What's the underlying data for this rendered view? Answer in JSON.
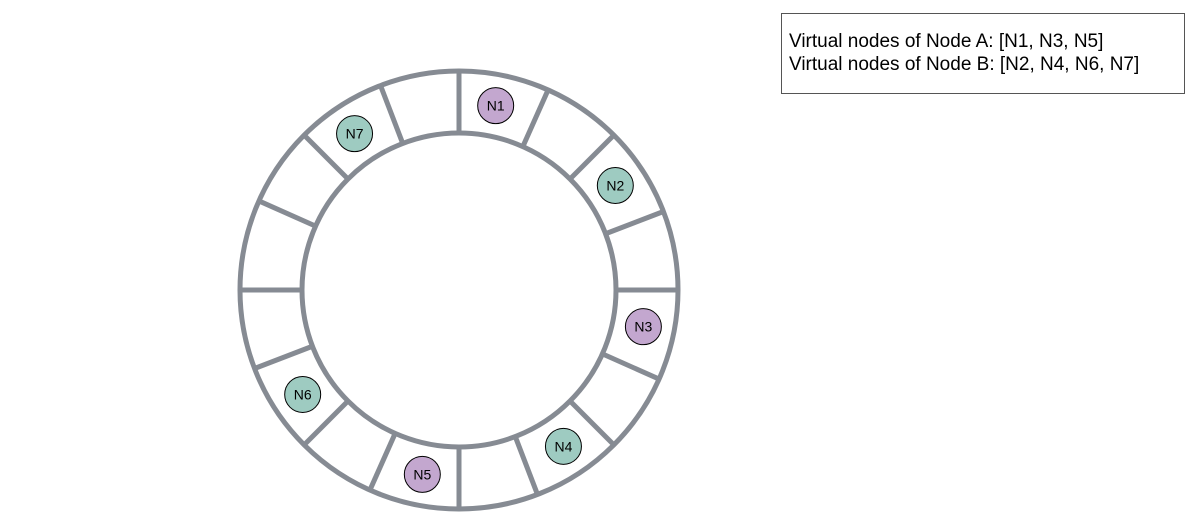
{
  "legend": {
    "line_a": "Virtual nodes of Node A: [N1, N3, N5]",
    "line_b": "Virtual nodes of Node B: [N2, N4, N6, N7]"
  },
  "colors": {
    "ring_stroke": "#868b93",
    "node_a_fill": "#c3a7cf",
    "node_b_fill": "#9ecbc1"
  },
  "ring": {
    "segment_count": 16
  },
  "nodes": [
    {
      "label": "N1",
      "owner": "A",
      "segment": 0
    },
    {
      "label": "N2",
      "owner": "B",
      "segment": 2
    },
    {
      "label": "N3",
      "owner": "A",
      "segment": 4
    },
    {
      "label": "N4",
      "owner": "B",
      "segment": 6
    },
    {
      "label": "N5",
      "owner": "A",
      "segment": 8
    },
    {
      "label": "N6",
      "owner": "B",
      "segment": 10
    },
    {
      "label": "N7",
      "owner": "B",
      "segment": 14
    }
  ]
}
